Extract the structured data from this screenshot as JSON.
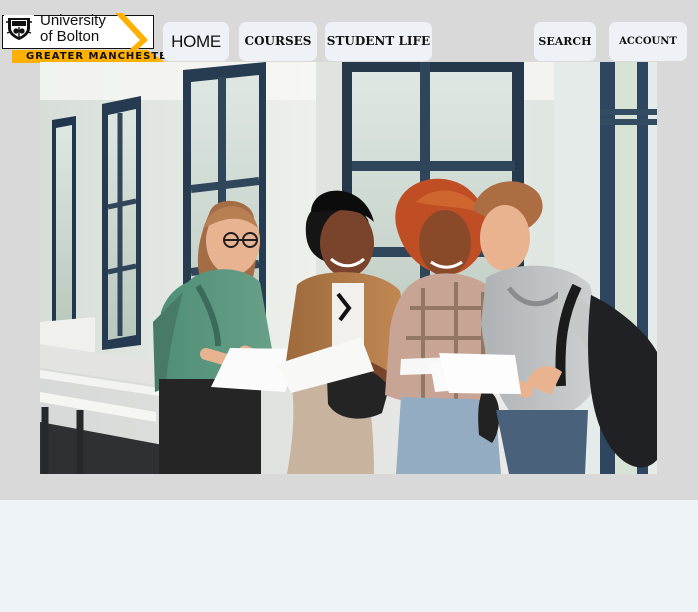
{
  "logo": {
    "name_line_1": "University",
    "name_line_2": "of Bolton",
    "location": "GREATER MANCHESTER",
    "colors": {
      "black": "#111111",
      "gold": "#ffb000",
      "white": "#ffffff"
    }
  },
  "navigation": {
    "home": "HOME",
    "courses": "COURSES",
    "student_life": "STUDENT LIFE",
    "search": "SEARCH",
    "account": "ACCOUNT"
  },
  "hero_image": {
    "subject": "students-reviewing-papers"
  },
  "theme": {
    "header_background": "#d9d9d9",
    "page_background": "#eef3f7",
    "button_background": "#eef2f6"
  }
}
